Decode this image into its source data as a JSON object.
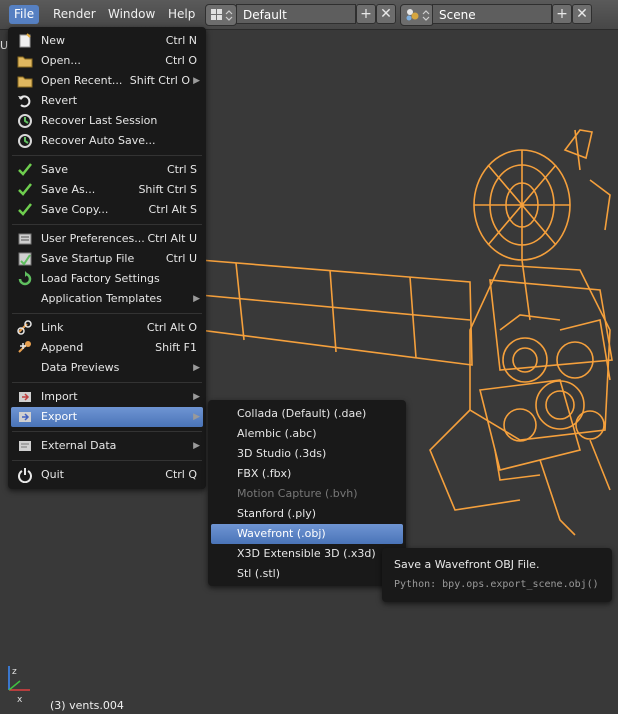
{
  "header": {
    "menus": [
      "File",
      "Render",
      "Window",
      "Help"
    ],
    "layout_field": "Default",
    "scene_field": "Scene",
    "plus_icon": "+",
    "close_icon": "✕"
  },
  "file_menu": {
    "items": [
      {
        "label": "New",
        "shortcut": "Ctrl N",
        "icon": "new-file-icon"
      },
      {
        "label": "Open...",
        "shortcut": "Ctrl O",
        "icon": "folder-icon"
      },
      {
        "label": "Open Recent...",
        "shortcut": "Shift Ctrl O",
        "icon": "folder-icon",
        "submenu": true
      },
      {
        "label": "Revert",
        "shortcut": "",
        "icon": "revert-icon"
      },
      {
        "label": "Recover Last Session",
        "shortcut": "",
        "icon": "recover-icon"
      },
      {
        "label": "Recover Auto Save...",
        "shortcut": "",
        "icon": "recover-icon"
      },
      {
        "label": "Save",
        "shortcut": "Ctrl S",
        "icon": "check-icon"
      },
      {
        "label": "Save As...",
        "shortcut": "Shift Ctrl S",
        "icon": "check-icon"
      },
      {
        "label": "Save Copy...",
        "shortcut": "Ctrl Alt S",
        "icon": "check-icon"
      },
      {
        "label": "User Preferences...",
        "shortcut": "Ctrl Alt U",
        "icon": "preferences-icon"
      },
      {
        "label": "Save Startup File",
        "shortcut": "Ctrl U",
        "icon": "save-icon"
      },
      {
        "label": "Load Factory Settings",
        "shortcut": "",
        "icon": "load-icon"
      },
      {
        "label": "Application Templates",
        "shortcut": "",
        "icon": "",
        "submenu": true
      },
      {
        "label": "Link",
        "shortcut": "Ctrl Alt O",
        "icon": "link-icon"
      },
      {
        "label": "Append",
        "shortcut": "Shift F1",
        "icon": "append-icon"
      },
      {
        "label": "Data Previews",
        "shortcut": "",
        "icon": "",
        "submenu": true
      },
      {
        "label": "Import",
        "shortcut": "",
        "icon": "import-icon",
        "submenu": true
      },
      {
        "label": "Export",
        "shortcut": "",
        "icon": "export-icon",
        "submenu": true
      },
      {
        "label": "External Data",
        "shortcut": "",
        "icon": "external-data-icon",
        "submenu": true
      },
      {
        "label": "Quit",
        "shortcut": "Ctrl Q",
        "icon": "power-icon"
      }
    ]
  },
  "export_menu": {
    "items": [
      {
        "label": "Collada (Default) (.dae)"
      },
      {
        "label": "Alembic (.abc)"
      },
      {
        "label": "3D Studio (.3ds)"
      },
      {
        "label": "FBX (.fbx)"
      },
      {
        "label": "Motion Capture (.bvh)",
        "disabled": true
      },
      {
        "label": "Stanford (.ply)"
      },
      {
        "label": "Wavefront (.obj)",
        "highlighted": true
      },
      {
        "label": "X3D Extensible 3D (.x3d)"
      },
      {
        "label": "Stl (.stl)"
      }
    ]
  },
  "tooltip": {
    "title": "Save a Wavefront OBJ File.",
    "python": "Python: bpy.ops.export_scene.obj()"
  },
  "status": {
    "object_info": "(3) vents.004",
    "side_letter": "U"
  },
  "colors": {
    "highlight": "#5680c2",
    "wireframe": "#f5a03c",
    "menu_bg": "#191919",
    "viewport_bg": "#393939"
  }
}
